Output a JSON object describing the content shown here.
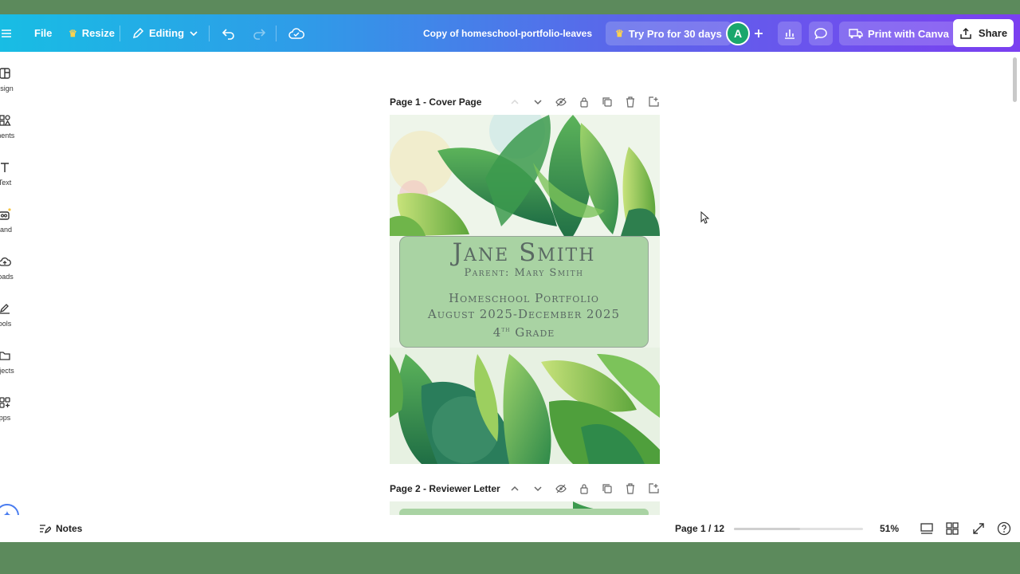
{
  "topbar": {
    "file_label": "File",
    "resize_label": "Resize",
    "editing_label": "Editing",
    "doc_title": "Copy of homeschool-portfolio-leaves",
    "pro_label": "Try Pro for 30 days",
    "avatar_initial": "A",
    "print_label": "Print with Canva",
    "share_label": "Share"
  },
  "sidebar": {
    "items": [
      {
        "label": "esign",
        "icon": "layout-icon"
      },
      {
        "label": "ments",
        "icon": "elements-icon"
      },
      {
        "label": "Text",
        "icon": "text-icon"
      },
      {
        "label": "rand",
        "icon": "brand-icon"
      },
      {
        "label": "loads",
        "icon": "upload-icon"
      },
      {
        "label": "ools",
        "icon": "draw-icon"
      },
      {
        "label": "ojects",
        "icon": "folder-icon"
      },
      {
        "label": "pps",
        "icon": "apps-icon"
      }
    ]
  },
  "pages": [
    {
      "title": "Page 1 - Cover Page"
    },
    {
      "title": "Page 2 - Reviewer Letter"
    }
  ],
  "cover": {
    "name": "Jane Smith",
    "parent": "Parent: Mary Smith",
    "line1": "Homeschool Portfolio",
    "line2": "August 2025-December 2025",
    "grade_num": "4",
    "grade_sup": "th",
    "grade_word": "Grade"
  },
  "bottombar": {
    "notes_label": "Notes",
    "page_count": "Page 1 / 12",
    "zoom": "51%",
    "zoom_fraction": 0.51
  },
  "colors": {
    "topbar_start": "#18bde4",
    "topbar_end": "#7b3ff0",
    "cover_box": "#a9d3a3",
    "frame_border": "#5c8a5c"
  }
}
